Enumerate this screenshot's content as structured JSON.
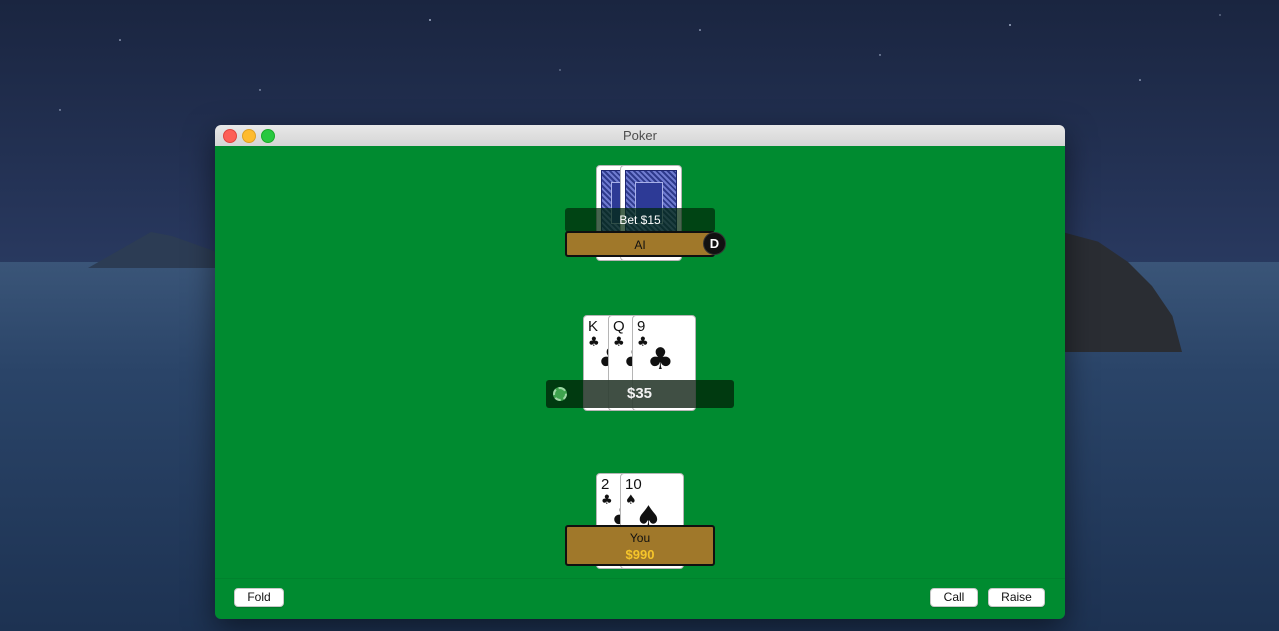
{
  "window": {
    "title": "Poker"
  },
  "ai": {
    "bet_label": "Bet $15",
    "name": "AI",
    "dealer_marker": "D",
    "cards": [
      "card-back",
      "card-back"
    ]
  },
  "board": {
    "cards": [
      {
        "rank": "K",
        "suit": "♣"
      },
      {
        "rank": "Q",
        "suit": "♣"
      },
      {
        "rank": "9",
        "suit": "♣"
      }
    ],
    "pot": "$35"
  },
  "you": {
    "name": "You",
    "money": "$990",
    "cards": [
      {
        "rank": "2",
        "suit": "♣"
      },
      {
        "rank": "10",
        "suit": "♠"
      }
    ]
  },
  "controls": {
    "fold": "Fold",
    "call": "Call",
    "raise": "Raise"
  },
  "colors": {
    "table": "#008b30",
    "plate": "#a0782a",
    "money": "#f6c52a"
  }
}
